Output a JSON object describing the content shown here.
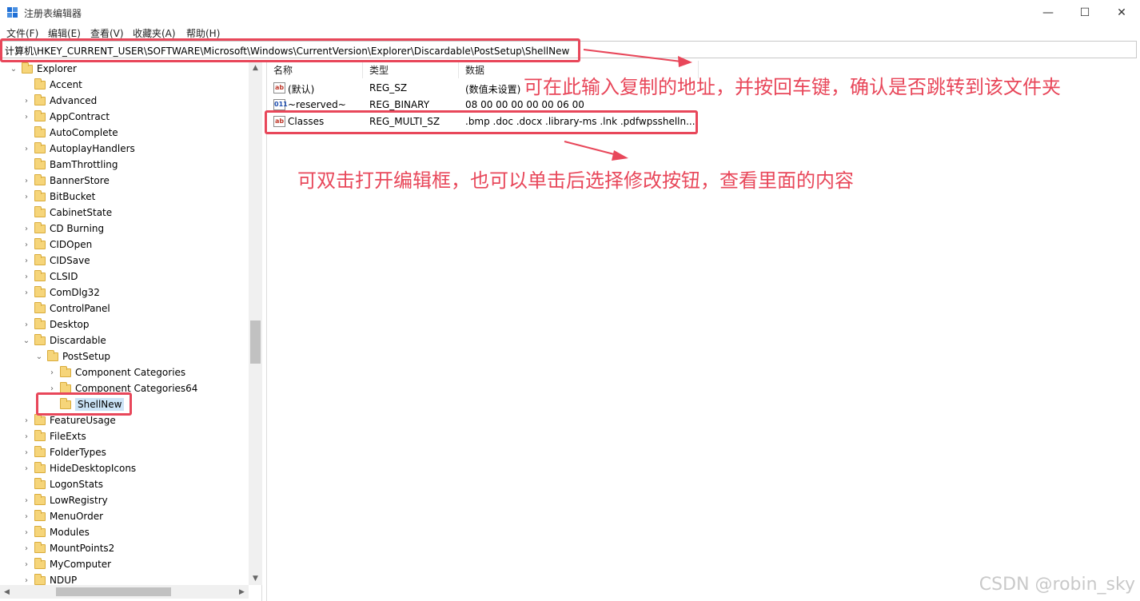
{
  "window": {
    "title": "注册表编辑器",
    "minimize_glyph": "—",
    "maximize_glyph": "☐",
    "close_glyph": "✕"
  },
  "menu": [
    "文件(F)",
    "编辑(E)",
    "查看(V)",
    "收藏夹(A)",
    "帮助(H)"
  ],
  "address": "计算机\\HKEY_CURRENT_USER\\SOFTWARE\\Microsoft\\Windows\\CurrentVersion\\Explorer\\Discardable\\PostSetup\\ShellNew",
  "tree": [
    {
      "label": "Explorer",
      "level": 0,
      "toggle": "v"
    },
    {
      "label": "Accent",
      "level": 1,
      "toggle": ""
    },
    {
      "label": "Advanced",
      "level": 1,
      "toggle": ">"
    },
    {
      "label": "AppContract",
      "level": 1,
      "toggle": ">"
    },
    {
      "label": "AutoComplete",
      "level": 1,
      "toggle": ""
    },
    {
      "label": "AutoplayHandlers",
      "level": 1,
      "toggle": ">"
    },
    {
      "label": "BamThrottling",
      "level": 1,
      "toggle": ""
    },
    {
      "label": "BannerStore",
      "level": 1,
      "toggle": ">"
    },
    {
      "label": "BitBucket",
      "level": 1,
      "toggle": ">"
    },
    {
      "label": "CabinetState",
      "level": 1,
      "toggle": ""
    },
    {
      "label": "CD Burning",
      "level": 1,
      "toggle": ">"
    },
    {
      "label": "CIDOpen",
      "level": 1,
      "toggle": ">"
    },
    {
      "label": "CIDSave",
      "level": 1,
      "toggle": ">"
    },
    {
      "label": "CLSID",
      "level": 1,
      "toggle": ">"
    },
    {
      "label": "ComDlg32",
      "level": 1,
      "toggle": ">"
    },
    {
      "label": "ControlPanel",
      "level": 1,
      "toggle": ""
    },
    {
      "label": "Desktop",
      "level": 1,
      "toggle": ">"
    },
    {
      "label": "Discardable",
      "level": 1,
      "toggle": "v"
    },
    {
      "label": "PostSetup",
      "level": 2,
      "toggle": "v"
    },
    {
      "label": "Component Categories",
      "level": 3,
      "toggle": ">"
    },
    {
      "label": "Component Categories64",
      "level": 3,
      "toggle": ">"
    },
    {
      "label": "ShellNew",
      "level": 3,
      "toggle": "",
      "selected": true
    },
    {
      "label": "FeatureUsage",
      "level": 1,
      "toggle": ">"
    },
    {
      "label": "FileExts",
      "level": 1,
      "toggle": ">"
    },
    {
      "label": "FolderTypes",
      "level": 1,
      "toggle": ">"
    },
    {
      "label": "HideDesktopIcons",
      "level": 1,
      "toggle": ">"
    },
    {
      "label": "LogonStats",
      "level": 1,
      "toggle": ""
    },
    {
      "label": "LowRegistry",
      "level": 1,
      "toggle": ">"
    },
    {
      "label": "MenuOrder",
      "level": 1,
      "toggle": ">"
    },
    {
      "label": "Modules",
      "level": 1,
      "toggle": ">"
    },
    {
      "label": "MountPoints2",
      "level": 1,
      "toggle": ">"
    },
    {
      "label": "MyComputer",
      "level": 1,
      "toggle": ">"
    },
    {
      "label": "NDUP",
      "level": 1,
      "toggle": ">"
    }
  ],
  "values_pane": {
    "columns": [
      "名称",
      "类型",
      "数据"
    ],
    "rows": [
      {
        "icon": "string-value-icon",
        "name": "(默认)",
        "type": "REG_SZ",
        "data": "(数值未设置)"
      },
      {
        "icon": "binary-value-icon",
        "name": "~reserved~",
        "type": "REG_BINARY",
        "data": "08 00 00 00 00 00 06 00"
      },
      {
        "icon": "string-value-icon",
        "name": "Classes",
        "type": "REG_MULTI_SZ",
        "data": ".bmp .doc .docx .library-ms .lnk .pdfwpsshelln..."
      }
    ]
  },
  "annotations": {
    "address_hint": "可在此输入复制的地址，并按回车键，确认是否跳转到该文件夹",
    "edit_hint": "可双击打开编辑框，也可以单击后选择修改按钮，查看里面的内容",
    "color": "#e8475a"
  },
  "watermark": "CSDN @robin_sky"
}
